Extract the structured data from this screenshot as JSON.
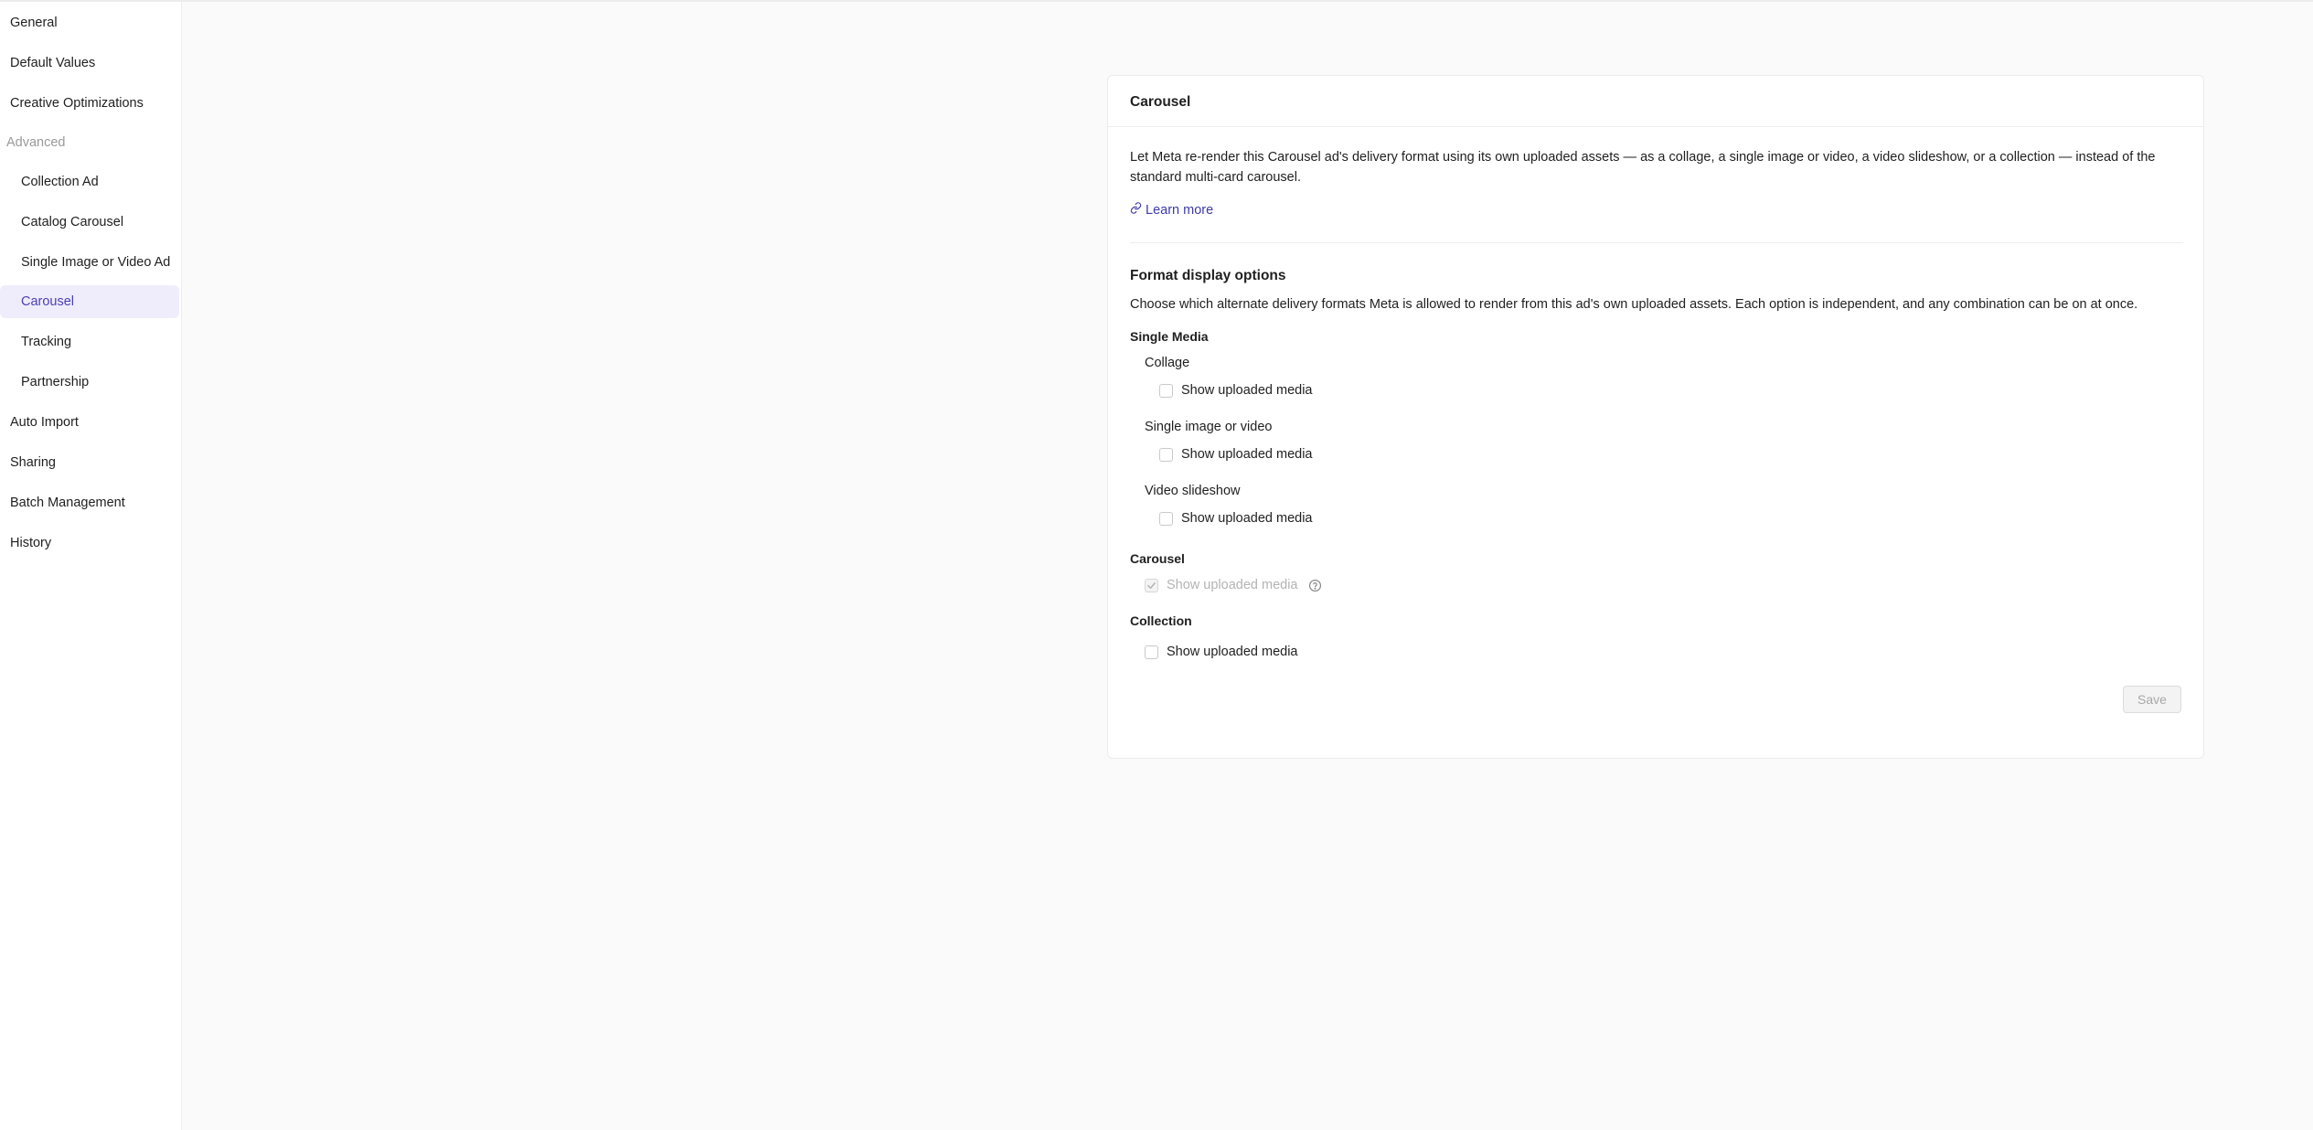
{
  "sidebar": {
    "items": [
      {
        "label": "General"
      },
      {
        "label": "Default Values"
      },
      {
        "label": "Creative Optimizations"
      },
      {
        "label": "Advanced"
      },
      {
        "label": "Collection Ad"
      },
      {
        "label": "Catalog Carousel"
      },
      {
        "label": "Single Image or Video Ad"
      },
      {
        "label": "Carousel"
      },
      {
        "label": "Tracking"
      },
      {
        "label": "Partnership"
      },
      {
        "label": "Auto Import"
      },
      {
        "label": "Sharing"
      },
      {
        "label": "Batch Management"
      },
      {
        "label": "History"
      }
    ],
    "active_label": "Carousel"
  },
  "card": {
    "title": "Carousel",
    "description": "Let Meta re-render this Carousel ad's delivery format using its own uploaded assets — as a collage, a single image or video, a video slideshow, or a collection — instead of the standard multi-card carousel.",
    "learn_more": "Learn more"
  },
  "format_options": {
    "title": "Format display options",
    "description": "Choose which alternate delivery formats Meta is allowed to render from this ad's own uploaded assets. Each option is independent, and any combination can be on at once.",
    "single_media": {
      "label": "Single Media",
      "collage": {
        "label": "Collage",
        "option": "Show uploaded media",
        "checked": false
      },
      "single_image_video": {
        "label": "Single image or video",
        "option": "Show uploaded media",
        "checked": false
      },
      "video_slideshow": {
        "label": "Video slideshow",
        "option": "Show uploaded media",
        "checked": false
      }
    },
    "carousel": {
      "label": "Carousel",
      "option": "Show uploaded media",
      "checked": true,
      "disabled": true
    },
    "collection": {
      "label": "Collection",
      "option": "Show uploaded media",
      "checked": false
    }
  },
  "actions": {
    "save_label": "Save"
  },
  "colors": {
    "accent": "#4a3fb5",
    "active_bg": "#efedfb",
    "link": "#3d3aa6"
  }
}
